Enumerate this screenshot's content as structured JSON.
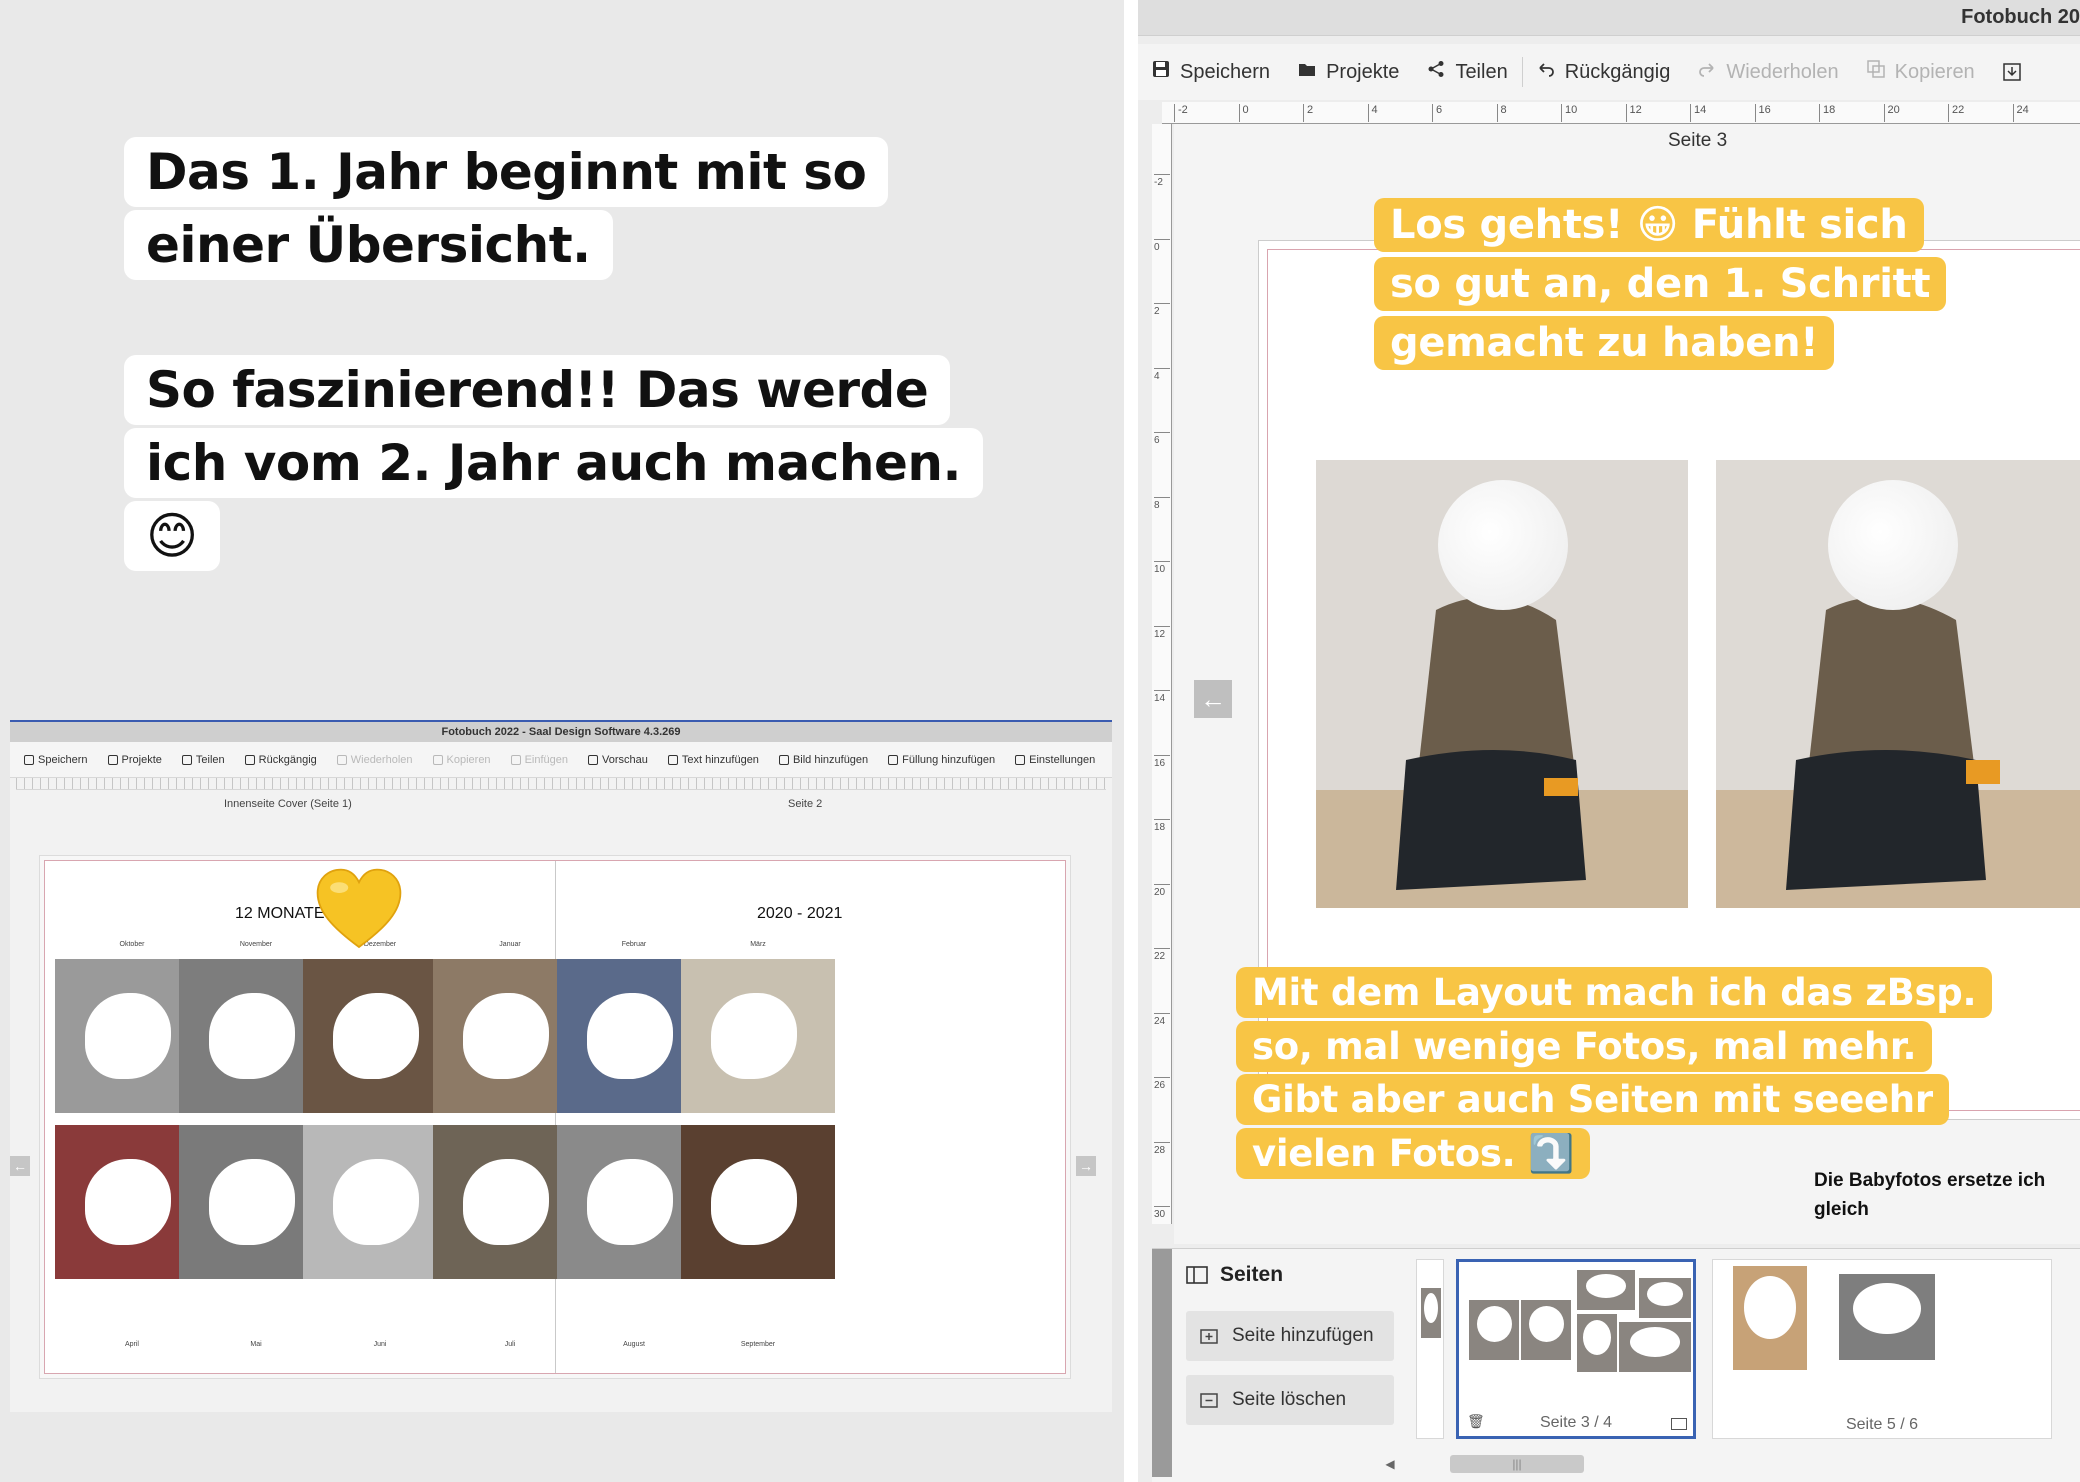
{
  "left": {
    "story_text_1": "Das 1. Jahr beginnt mit so einer Übersicht.",
    "story_text_2": "So faszinierend!! Das werde ich vom 2. Jahr auch machen. 😊",
    "mini_app": {
      "title": "Fotobuch 2022 - Saal Design Software 4.3.269",
      "toolbar": [
        {
          "label": "Speichern",
          "icon": "save-icon",
          "enabled": true
        },
        {
          "label": "Projekte",
          "icon": "folder-icon",
          "enabled": true
        },
        {
          "label": "Teilen",
          "icon": "share-icon",
          "enabled": true
        },
        {
          "label": "Rückgängig",
          "icon": "undo-icon",
          "enabled": true
        },
        {
          "label": "Wiederholen",
          "icon": "redo-icon",
          "enabled": false
        },
        {
          "label": "Kopieren",
          "icon": "copy-icon",
          "enabled": false
        },
        {
          "label": "Einfügen",
          "icon": "paste-icon",
          "enabled": false
        },
        {
          "label": "Vorschau",
          "icon": "eye-icon",
          "enabled": true
        },
        {
          "label": "Text hinzufügen",
          "icon": "text-icon",
          "enabled": true
        },
        {
          "label": "Bild hinzufügen",
          "icon": "image-add-icon",
          "enabled": true
        },
        {
          "label": "Füllung hinzufügen",
          "icon": "fill-add-icon",
          "enabled": true
        },
        {
          "label": "Einstellungen",
          "icon": "gear-icon",
          "enabled": true
        }
      ],
      "page_label_left": "Innenseite Cover (Seite 1)",
      "page_label_right": "Seite 2",
      "heading_left": "12 MONATE",
      "heading_right": "2020 - 2021",
      "months_top": [
        "Oktober",
        "November",
        "Dezember",
        "Januar",
        "Februar",
        "März"
      ],
      "months_bottom": [
        "April",
        "Mai",
        "Juni",
        "Juli",
        "August",
        "September"
      ],
      "photo_tones": [
        "#9a9a9a",
        "#7d7d7d",
        "#6a5544",
        "#8d7a66",
        "#5a6a8a",
        "#c8c0b0",
        "#8a3a3a",
        "#7a7a7a",
        "#b8b8b8",
        "#6e6456",
        "#8a8a8a",
        "#5a4030"
      ]
    },
    "heart_emoji": "💛"
  },
  "right": {
    "title": "Fotobuch 20",
    "toolbar": [
      {
        "label": "Speichern",
        "icon": "save-icon",
        "enabled": true
      },
      {
        "label": "Projekte",
        "icon": "folder-icon",
        "enabled": true
      },
      {
        "label": "Teilen",
        "icon": "share-icon",
        "enabled": true
      },
      {
        "label": "Rückgängig",
        "icon": "undo-icon",
        "enabled": true
      },
      {
        "label": "Wiederholen",
        "icon": "redo-icon",
        "enabled": false
      },
      {
        "label": "Kopieren",
        "icon": "copy-icon",
        "enabled": false
      }
    ],
    "ruler_top": [
      "-2",
      "0",
      "2",
      "4",
      "6",
      "8",
      "10",
      "12",
      "14",
      "16",
      "18",
      "20",
      "22",
      "24"
    ],
    "ruler_left": [
      "-2",
      "0",
      "2",
      "4",
      "6",
      "8",
      "10",
      "12",
      "14",
      "16",
      "18",
      "20",
      "22",
      "24",
      "26",
      "28",
      "30"
    ],
    "page_label": "Seite 3",
    "callout_1": "Los gehts! 😀 Fühlt sich so gut an, den 1. Schritt gemacht zu haben!",
    "callout_2": "Mit dem Layout mach ich das zBsp. so, mal wenige Fotos, mal mehr. Gibt aber auch Seiten mit seeehr vielen Fotos. ⤵️",
    "note": "Die Babyfotos ersetze ich gleich",
    "pages_panel": {
      "title": "Seiten",
      "add_label": "Seite hinzufügen",
      "delete_label": "Seite löschen",
      "thumbs": [
        {
          "label": "Seite 3 / 4",
          "selected": true
        },
        {
          "label": "Seite 5 / 6",
          "selected": false
        }
      ]
    },
    "accent_yellow": "#f8c545",
    "selection_blue": "#3a63b3"
  }
}
